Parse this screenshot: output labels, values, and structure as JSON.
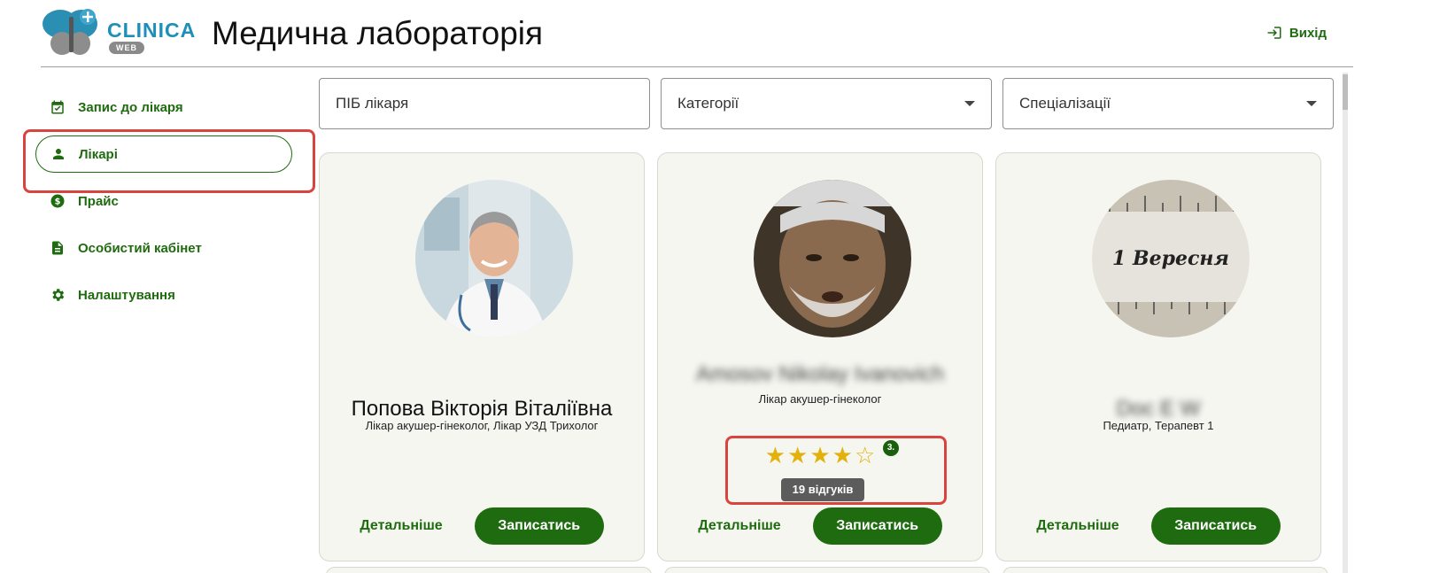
{
  "header": {
    "logo_text": "CLINICA",
    "logo_badge": "WEB",
    "title": "Медична лабораторія",
    "logout_label": "Вихід"
  },
  "sidebar": {
    "items": [
      {
        "label": "Запис до лікаря",
        "icon": "calendar-icon"
      },
      {
        "label": "Лікарі",
        "icon": "person-icon",
        "active": true
      },
      {
        "label": "Прайс",
        "icon": "dollar-icon"
      },
      {
        "label": "Особистий кабінет",
        "icon": "document-icon"
      },
      {
        "label": "Налаштування",
        "icon": "gear-icon"
      }
    ]
  },
  "filters": {
    "name_placeholder": "ПІБ лікаря",
    "category_label": "Категорії",
    "specialization_label": "Спеціалізації"
  },
  "cards": [
    {
      "name": "Попова Вікторія Віталіївна",
      "specialization": "Лікар акушер-гінеколог, Лікар УЗД Трихолог",
      "details_label": "Детальніше",
      "book_label": "Записатись"
    },
    {
      "name": "Amosov Nikolay Ivanovich",
      "specialization": "Лікар акушер-гінеколог",
      "rating": 4,
      "rating_max": 5,
      "rating_badge": "3.",
      "reviews_tooltip": "19 відгуків",
      "details_label": "Детальніше",
      "book_label": "Записатись"
    },
    {
      "name": "Doc E W",
      "specialization": "Педиатр, Терапевт 1",
      "avatar_caption": "1 Вересня",
      "details_label": "Детальніше",
      "book_label": "Записатись"
    }
  ],
  "colors": {
    "primary": "#1f6b10",
    "accent_logo": "#1e8fb8",
    "highlight": "#d9443e",
    "star": "#e2b20b",
    "card_bg": "#f6f6f1"
  }
}
